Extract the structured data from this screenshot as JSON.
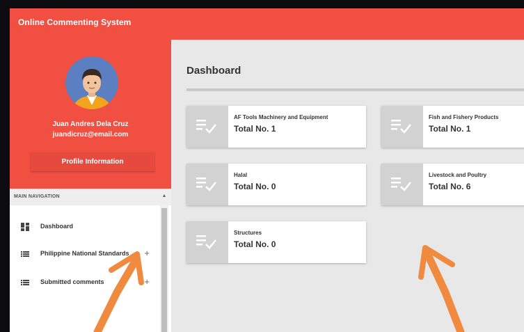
{
  "app": {
    "title": "Online Commenting System"
  },
  "user": {
    "name": "Juan Andres Dela Cruz",
    "email": "juandicruz@email.com",
    "profile_button": "Profile Information"
  },
  "nav": {
    "header": "MAIN NAVIGATION",
    "items": [
      {
        "label": "Dashboard",
        "icon": "dashboard-icon"
      },
      {
        "label": "Philippine National Standards",
        "icon": "list-icon",
        "expand": "+"
      },
      {
        "label": "Submitted comments",
        "icon": "list-icon",
        "expand": "+"
      }
    ]
  },
  "main": {
    "title": "Dashboard",
    "cards": [
      {
        "name": "AF Tools Machinery and Equipment",
        "total": "Total No. 1"
      },
      {
        "name": "Fish and Fishery Products",
        "total": "Total No. 1"
      },
      {
        "name": "Halal",
        "total": "Total No. 0"
      },
      {
        "name": "Livestock and Poultry",
        "total": "Total No. 6"
      },
      {
        "name": "Structures",
        "total": "Total No. 0"
      }
    ]
  },
  "colors": {
    "brand": "#f04f42",
    "annotation": "#f08a3e"
  }
}
